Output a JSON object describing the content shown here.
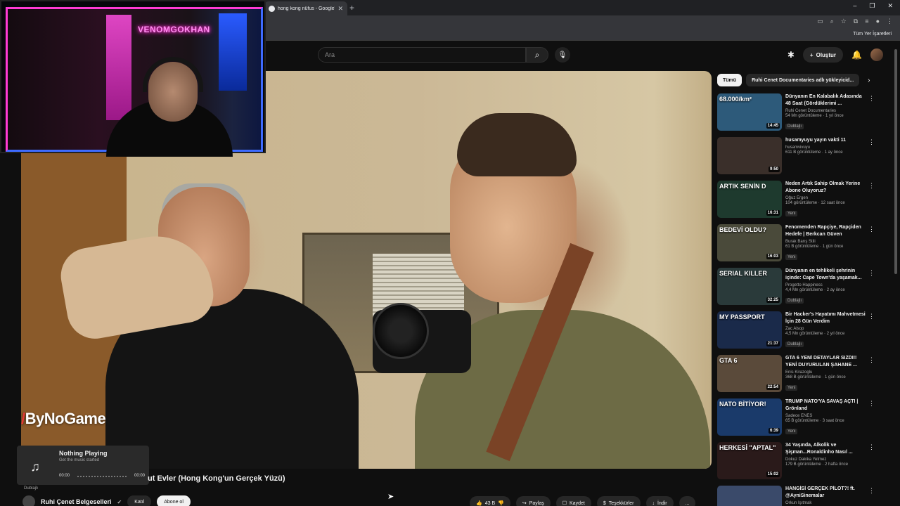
{
  "browser": {
    "tab_title": "hong kong nüfus - Google'da A",
    "new_tab": "+",
    "window_controls": [
      "–",
      "❐",
      "✕"
    ],
    "bookmarks_label": "Tüm Yer İşaretleri"
  },
  "header": {
    "search_placeholder": "Ara",
    "create_label": "Oluştur"
  },
  "webcam": {
    "neon_sign": "VENOMGOKHAN"
  },
  "video": {
    "watermark": "ByNoGame",
    "title": "...but Evler (Hong Kong'un Gerçek Yüzü)",
    "title_visible": "ut Evler (Hong Kong'un Gerçek Yüzü)",
    "dub_label": "Dublajlı"
  },
  "music": {
    "status": "Nothing Playing",
    "subtitle": "Get the music started",
    "time_start": "00:00",
    "time_end": "00:00"
  },
  "channel": {
    "name": "Ruhi Çenet Belgeselleri",
    "join_label": "Katıl",
    "subscribe_label": "Abone ol"
  },
  "actions": {
    "likes": "43 B",
    "share": "Paylaş",
    "save": "Kaydet",
    "thanks": "Teşekkürler",
    "download": "İndir",
    "more": "..."
  },
  "sidebar": {
    "chips": [
      "Tümü",
      "Ruhi Cenet Documentaries adlı yükleyicid..."
    ],
    "recommendations": [
      {
        "title": "Dünyanın En Kalabalık Adasında 48 Saat (Gördüklerimi ...",
        "channel": "Ruhi Cenet Documentaries",
        "meta": "54 Mn görüntüleme · 1 yıl önce",
        "badge": "Dublajlı",
        "duration": "14:45",
        "thumb_text": "68.000/km²",
        "thumb_color": "#2d5a7a"
      },
      {
        "title": "husamyuyu yayın vakti 11",
        "channel": "husamvivuyu",
        "meta": "611 B görüntüleme · 1 ay önce",
        "badge": "",
        "duration": "9:50",
        "thumb_text": "",
        "thumb_color": "#3a2f2a"
      },
      {
        "title": "Neden Artık Sahip Olmak Yerine Abone Oluyoruz?",
        "channel": "Oğuz Ergen",
        "meta": "104 görüntüleme · 12 saat önce",
        "badge": "Yeni",
        "duration": "16:31",
        "thumb_text": "ARTIK SENİN D",
        "thumb_color": "#1e3a2e"
      },
      {
        "title": "Fenomenden Rapçiye, Rapçiden Hedefe | Berkcan Güven",
        "channel": "Burak Barış Stili",
        "meta": "61 B görüntüleme · 1 gün önce",
        "badge": "Yeni",
        "duration": "16:03",
        "thumb_text": "BEDEVİ OLDU?",
        "thumb_color": "#4a4a3a"
      },
      {
        "title": "Dünyanın en tehlikeli şehrinin içinde: Cape Town'da yaşamak...",
        "channel": "Progetto Happiness",
        "meta": "4,4 Mn görüntüleme · 2 ay önce",
        "badge": "Dublajlı",
        "duration": "32:25",
        "thumb_text": "SERIAL KILLER",
        "thumb_color": "#2a3a3a"
      },
      {
        "title": "Bir Hacker's Hayatımı Mahvetmesi İçin 28 Gün Verdim",
        "channel": "Zac Alsop",
        "meta": "4,5 Mn görüntüleme · 2 yıl önce",
        "badge": "Dublajlı",
        "duration": "21:37",
        "thumb_text": "MY PASSPORT",
        "thumb_color": "#1a2a4a"
      },
      {
        "title": "GTA 6 YENİ DETAYLAR SIZDI!! YENİ DUYURULAN ŞAHANE ...",
        "channel": "Enis Kirazoglu",
        "meta": "368 B görüntüleme · 1 gün önce",
        "badge": "Yeni",
        "duration": "22:54",
        "thumb_text": "GTA 6",
        "thumb_color": "#5a4a3a"
      },
      {
        "title": "TRUMP NATO'YA SAVAŞ AÇTI | Grönland",
        "channel": "Sadece ENES",
        "meta": "65 B görüntüleme · 3 saat önce",
        "badge": "Yeni",
        "duration": "6:39",
        "thumb_text": "NATO BİTİYOR!",
        "thumb_color": "#1a3a6a"
      },
      {
        "title": "34 Yaşında, Alkolik ve Şişman...Ronaldinho Nasıl ...",
        "channel": "Dokuz Dakika Yetmez",
        "meta": "179 B görüntüleme · 2 hafta önce",
        "badge": "",
        "duration": "15:02",
        "thumb_text": "HERKESİ \"APTAL\"",
        "thumb_color": "#2a1a1a"
      },
      {
        "title": "HANGİSİ GERÇEK PİLOT?! ft. @AyniSinemalar",
        "channel": "Orkun Işıtmak",
        "meta": "",
        "badge": "",
        "duration": "",
        "thumb_text": "",
        "thumb_color": "#3a4a6a"
      }
    ]
  }
}
